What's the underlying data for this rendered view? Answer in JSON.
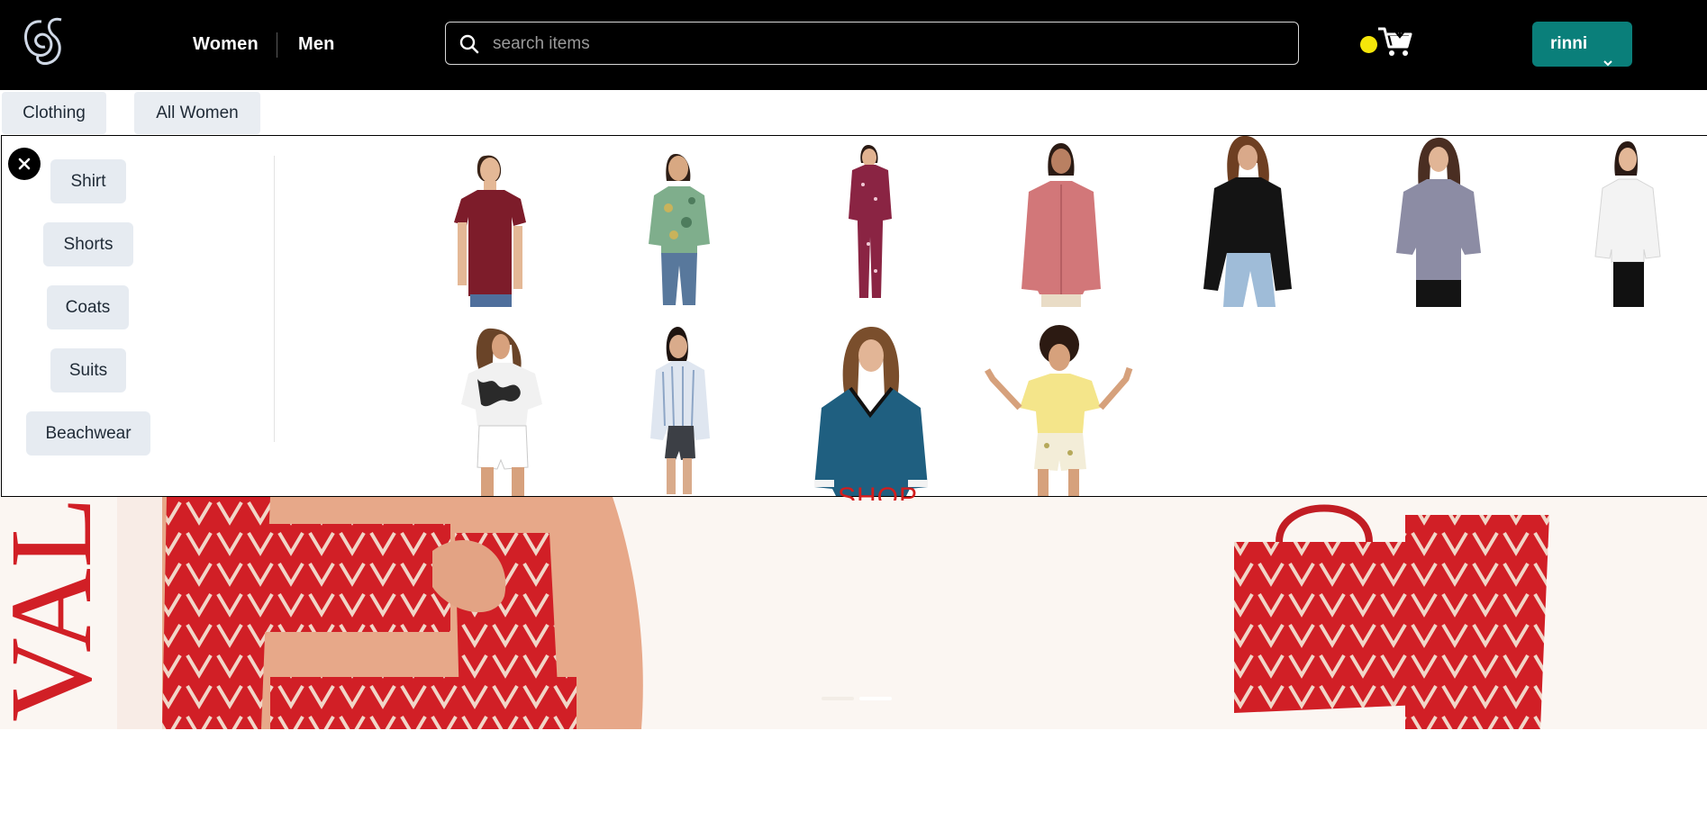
{
  "header": {
    "nav": {
      "women": "Women",
      "men": "Men"
    },
    "search": {
      "placeholder": "search items",
      "value": ""
    },
    "user": {
      "name": "rinni"
    },
    "brand_color": "#0a7f7a",
    "icons": [
      "logo-icon",
      "search-icon",
      "status-dot-icon",
      "cart-icon",
      "chevron-down-icon"
    ]
  },
  "category_tabs": [
    "Clothing",
    "All Women"
  ],
  "mega_menu": {
    "subcategories": [
      "Shirt",
      "Shorts",
      "Coats",
      "Suits",
      "Beachwear"
    ],
    "close_icon": "close-icon",
    "products": [
      {
        "name": "maroon polo top",
        "color": "#7d1c2a"
      },
      {
        "name": "green floral shirt",
        "color": "#7fae8c"
      },
      {
        "name": "plum print pajama set",
        "color": "#8a2443"
      },
      {
        "name": "pink button shirt",
        "color": "#d27779"
      },
      {
        "name": "black shirt",
        "color": "#141414"
      },
      {
        "name": "grey shirt",
        "color": "#8c8ca4"
      },
      {
        "name": "white shirt",
        "color": "#f3f3f3"
      },
      {
        "name": "black white floral shirt",
        "color": "#2a2a2a"
      },
      {
        "name": "striped shirt",
        "color": "#b9c9dc"
      },
      {
        "name": "teal v-neck sweater",
        "color": "#1f5f80"
      },
      {
        "name": "yellow tee",
        "color": "#f4e58a"
      }
    ]
  },
  "banner": {
    "cta": "SHOP NOW",
    "vertical_text": "VAL",
    "accent_color": "#d31d1d"
  }
}
